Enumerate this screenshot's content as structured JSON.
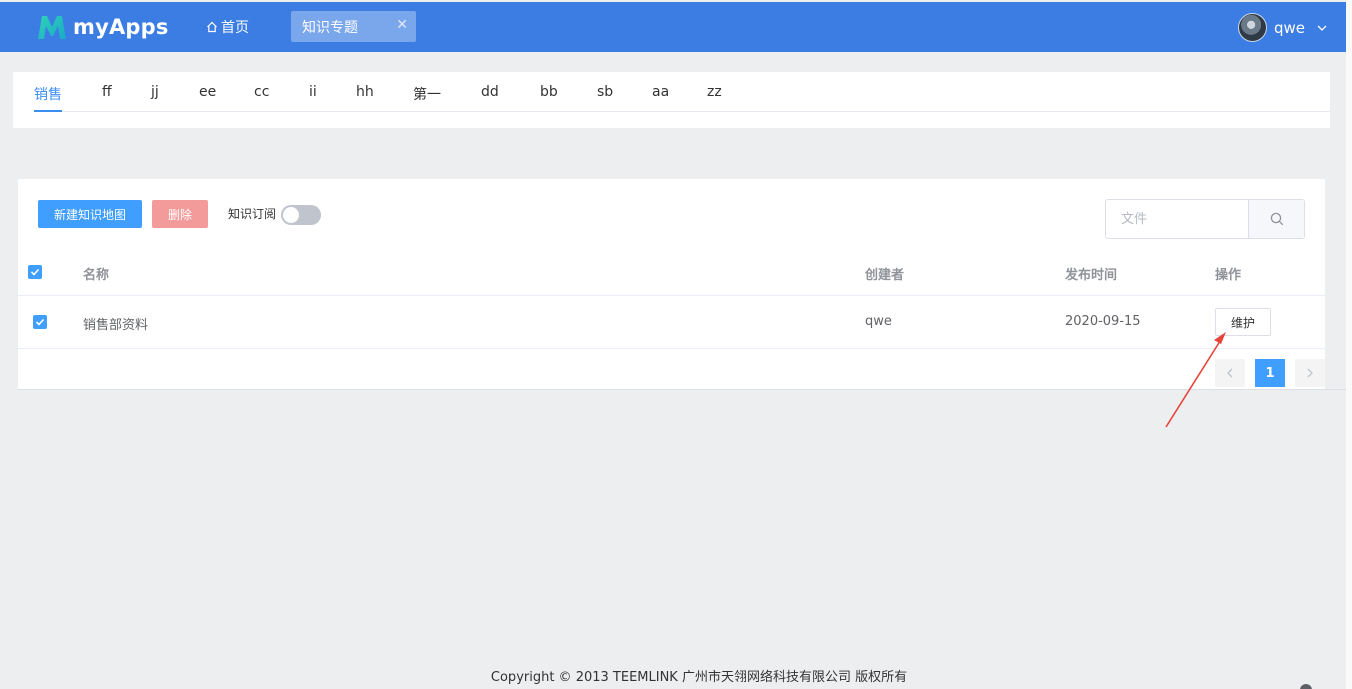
{
  "header": {
    "logo_text": "myApps",
    "home_label": "首页",
    "open_tab": "知识专题",
    "user_name": "qwe"
  },
  "categories": {
    "items": [
      "销售",
      "ff",
      "jj",
      "ee",
      "cc",
      "ii",
      "hh",
      "第一",
      "dd",
      "bb",
      "sb",
      "aa",
      "zz"
    ],
    "active_index": 0
  },
  "toolbar": {
    "new_label": "新建知识地图",
    "delete_label": "删除",
    "subscribe_label": "知识订阅",
    "subscribe_on": false,
    "search_placeholder": "文件"
  },
  "table": {
    "columns": [
      "名称",
      "创建者",
      "发布时间",
      "操作"
    ],
    "rows": [
      {
        "name": "销售部资料",
        "creator": "qwe",
        "date": "2020-09-15",
        "action": "维护",
        "checked": true
      }
    ],
    "all_checked": true
  },
  "pagination": {
    "current": "1"
  },
  "footer": {
    "text": "Copyright © 2013 TEEMLINK 广州市天翎网络科技有限公司 版权所有"
  },
  "colors": {
    "header": "#3b7de3",
    "primary": "#409eff",
    "danger": "#f39a9a",
    "annotation": "#e8443a"
  }
}
